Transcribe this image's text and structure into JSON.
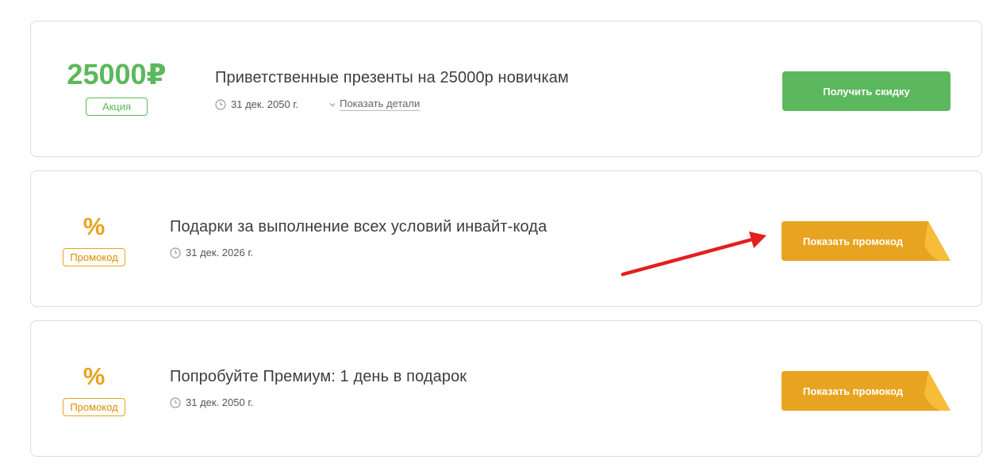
{
  "offers": [
    {
      "value": "25000₽",
      "badge": "Акция",
      "title": "Приветственные презенты на 25000р новичкам",
      "date": "31 дек. 2050 г.",
      "details_label": "Показать детали",
      "button_label": "Получить скидку"
    },
    {
      "value": "%",
      "badge": "Промокод",
      "title": "Подарки за выполнение всех условий инвайт-кода",
      "date": "31 дек. 2026 г.",
      "button_label": "Показать промокод"
    },
    {
      "value": "%",
      "badge": "Промокод",
      "title": "Попробуйте Премиум: 1 день в подарок",
      "date": "31 дек. 2050 г.",
      "button_label": "Показать промокод"
    }
  ],
  "colors": {
    "green": "#5cb85c",
    "orange": "#e8a420",
    "orange_fold": "#f7bc3a",
    "arrow_red": "#e41e1e"
  },
  "icons": [
    "clock-icon",
    "chevron-down-icon",
    "red-arrow-annotation"
  ]
}
